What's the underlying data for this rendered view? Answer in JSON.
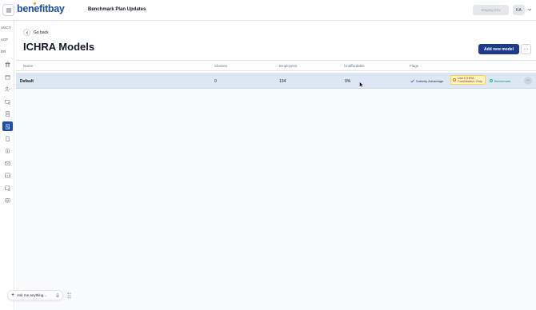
{
  "header": {
    "logo": "benefitbay",
    "page_title": "Benchmark Plan Updates",
    "env_label": "Staging Env",
    "user_initials": "KA"
  },
  "sidebar": {
    "text_items": [
      "AGCY",
      "AGT",
      "ER"
    ],
    "icons": [
      "bank-icon",
      "calendar-icon",
      "people-icon",
      "card-settings-icon",
      "document-list-icon",
      "ichra-icon",
      "file-icon",
      "institution-icon",
      "mail-icon",
      "report-icon",
      "report-settings-icon",
      "camera-icon"
    ],
    "active_icon": "ichra-icon"
  },
  "main": {
    "back_label": "Go back",
    "title": "ICHRA Models",
    "add_button": "Add new model",
    "more_button": "···"
  },
  "table": {
    "columns": [
      "Name",
      "Classes",
      "Employees",
      "Unaffordable",
      "Flags"
    ],
    "rows": [
      {
        "name": "Default",
        "classes": "0",
        "employees": "134",
        "unaffordable": "9%",
        "flags": {
          "subsidy": "Subsidy Advantage",
          "ichra_line1": "Use ICHRA",
          "ichra_line2": "Contribution Only",
          "benchmark": "Benchmark"
        },
        "action": "···"
      }
    ]
  },
  "assistant": {
    "plus": "+",
    "placeholder": "Ask me anything..."
  },
  "colors": {
    "brand": "#1e4fa8",
    "primary_button": "#1e3a8a",
    "row_highlight": "#dde6f3",
    "ichra_flag_bg": "#fef3c7",
    "benchmark_green": "#059669"
  }
}
